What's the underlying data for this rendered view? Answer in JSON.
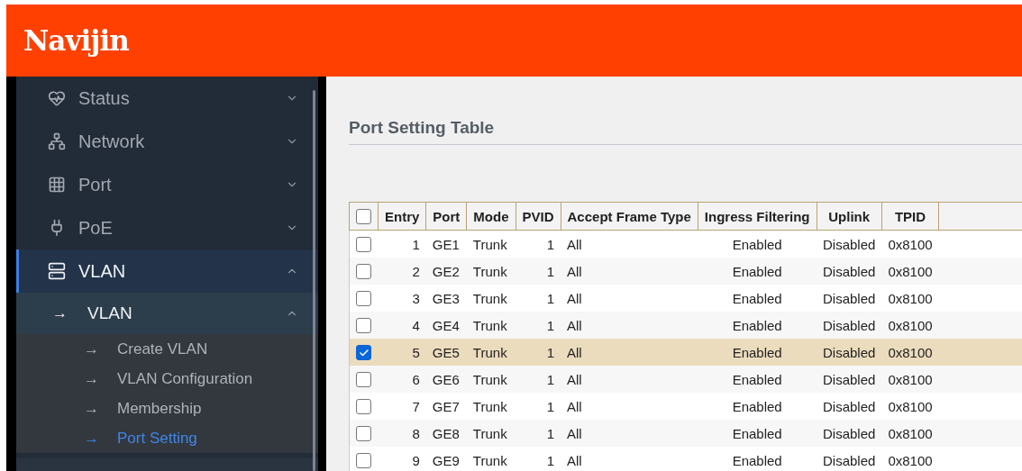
{
  "header": {
    "logo": "Navijin"
  },
  "sidebar": {
    "items": [
      {
        "label": "Status",
        "expanded": false,
        "selected": false
      },
      {
        "label": "Network",
        "expanded": false,
        "selected": false
      },
      {
        "label": "Port",
        "expanded": false,
        "selected": false
      },
      {
        "label": "PoE",
        "expanded": false,
        "selected": false
      },
      {
        "label": "VLAN",
        "expanded": true,
        "selected": true,
        "children": [
          {
            "label": "VLAN",
            "arrow": "→",
            "expanded": true,
            "children": [
              {
                "label": "Create VLAN",
                "arrow": "→",
                "selected": false
              },
              {
                "label": "VLAN Configuration",
                "arrow": "→",
                "selected": false
              },
              {
                "label": "Membership",
                "arrow": "→",
                "selected": false
              },
              {
                "label": "Port Setting",
                "arrow": "→",
                "selected": true
              }
            ]
          }
        ]
      }
    ]
  },
  "content": {
    "title": "Port Setting Table",
    "table": {
      "columns": [
        "Entry",
        "Port",
        "Mode",
        "PVID",
        "Accept Frame Type",
        "Ingress Filtering",
        "Uplink",
        "TPID"
      ],
      "header_checked": false,
      "rows": [
        {
          "checked": false,
          "cells": [
            "1",
            "GE1",
            "Trunk",
            "1",
            "All",
            "Enabled",
            "Disabled",
            "0x8100"
          ]
        },
        {
          "checked": false,
          "cells": [
            "2",
            "GE2",
            "Trunk",
            "1",
            "All",
            "Enabled",
            "Disabled",
            "0x8100"
          ]
        },
        {
          "checked": false,
          "cells": [
            "3",
            "GE3",
            "Trunk",
            "1",
            "All",
            "Enabled",
            "Disabled",
            "0x8100"
          ]
        },
        {
          "checked": false,
          "cells": [
            "4",
            "GE4",
            "Trunk",
            "1",
            "All",
            "Enabled",
            "Disabled",
            "0x8100"
          ]
        },
        {
          "checked": true,
          "cells": [
            "5",
            "GE5",
            "Trunk",
            "1",
            "All",
            "Enabled",
            "Disabled",
            "0x8100"
          ]
        },
        {
          "checked": false,
          "cells": [
            "6",
            "GE6",
            "Trunk",
            "1",
            "All",
            "Enabled",
            "Disabled",
            "0x8100"
          ]
        },
        {
          "checked": false,
          "cells": [
            "7",
            "GE7",
            "Trunk",
            "1",
            "All",
            "Enabled",
            "Disabled",
            "0x8100"
          ]
        },
        {
          "checked": false,
          "cells": [
            "8",
            "GE8",
            "Trunk",
            "1",
            "All",
            "Enabled",
            "Disabled",
            "0x8100"
          ]
        },
        {
          "checked": false,
          "cells": [
            "9",
            "GE9",
            "Trunk",
            "1",
            "All",
            "Enabled",
            "Disabled",
            "0x8100"
          ]
        }
      ]
    }
  }
}
